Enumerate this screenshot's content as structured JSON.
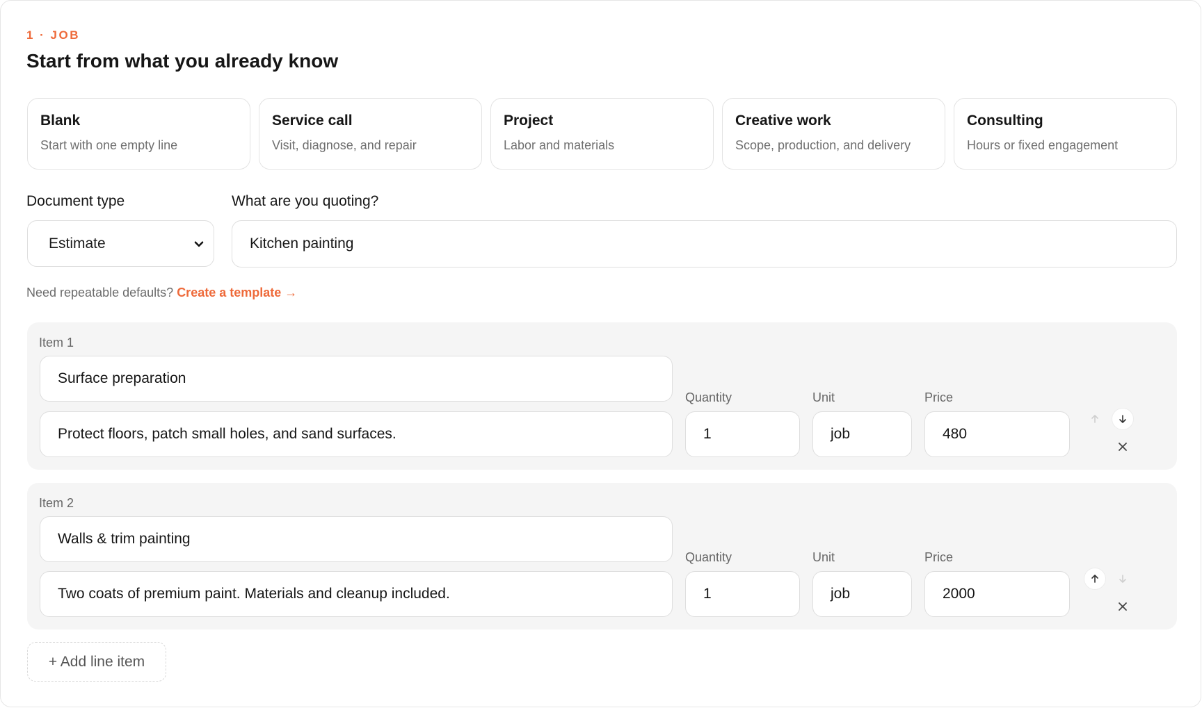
{
  "section": {
    "step": "1 · JOB",
    "title": "Start from what you already know"
  },
  "templates": [
    {
      "name": "Blank",
      "desc": "Start with one empty line"
    },
    {
      "name": "Service call",
      "desc": "Visit, diagnose, and repair"
    },
    {
      "name": "Project",
      "desc": "Labor and materials"
    },
    {
      "name": "Creative work",
      "desc": "Scope, production, and delivery"
    },
    {
      "name": "Consulting",
      "desc": "Hours or fixed engagement"
    }
  ],
  "form": {
    "doc_type_label": "Document type",
    "doc_type_value": "Estimate",
    "quoting_label": "What are you quoting?",
    "quoting_value": "Kitchen painting"
  },
  "hint": {
    "text": "Need repeatable defaults?",
    "link": "Create a template →"
  },
  "columns": {
    "quantity": "Quantity",
    "unit": "Unit",
    "price": "Price"
  },
  "items": [
    {
      "label": "Item 1",
      "name": "Surface preparation",
      "description": "Protect floors, patch small holes, and sand surfaces.",
      "quantity": "1",
      "unit": "job",
      "price": "480"
    },
    {
      "label": "Item 2",
      "name": "Walls & trim painting",
      "description": "Two coats of premium paint. Materials and cleanup included.",
      "quantity": "1",
      "unit": "job",
      "price": "2000"
    }
  ],
  "add_line_label": "+ Add line item",
  "colors": {
    "accent": "#ee6a3a",
    "item_bg": "#f5f5f5",
    "border": "#dedede"
  },
  "icons": [
    "chevron-down-icon",
    "arrow-up-icon",
    "arrow-down-icon",
    "close-icon"
  ]
}
